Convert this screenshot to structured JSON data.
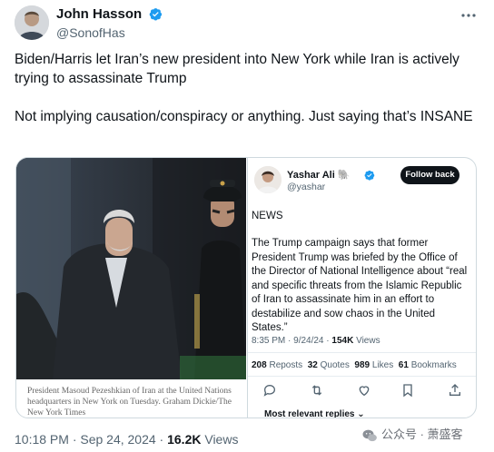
{
  "author": {
    "name": "John Hasson",
    "handle": "@SonofHas"
  },
  "tweet": {
    "paragraphs": [
      "Biden/Harris let Iran’s new president into New York while Iran is actively trying to assassinate Trump",
      "Not implying causation/conspiracy or anything. Just saying that’s INSANE"
    ],
    "timestamp": "10:18 PM · Sep 24, 2024 · ",
    "views_count": "16.2K",
    "views_label": " Views"
  },
  "quote": {
    "photo_caption": "President Masoud Pezeshkian of Iran at the United Nations headquarters in New York on Tuesday. Graham Dickie/The New York Times",
    "inner": {
      "author_name": "Yashar Ali 🐘",
      "author_handle": "@yashar",
      "follow_label": "Follow back",
      "heading": "NEWS",
      "body": "The Trump campaign says that former President Trump was briefed by the Office of the Director of National Intelligence about “real and specific threats from the Islamic Republic of Iran to assassinate him in an effort to destabilize and sow chaos in the United States.”",
      "time": "8:35 PM · 9/24/24 · ",
      "views_count": "154K",
      "views_label": " Views",
      "reposts_count": "208",
      "reposts_label": " Reposts  ",
      "quotes_count": "32",
      "quotes_label": " Quotes  ",
      "likes_count": "989",
      "likes_label": " Likes  ",
      "bookmarks_count": "61",
      "bookmarks_label": " Bookmarks",
      "more_replies": "Most relevant replies ⌄"
    }
  },
  "watermark": "公众号 · 萧盛客",
  "colors": {
    "verified_blue": "#1d9bf0",
    "text_primary": "#0f1419",
    "text_secondary": "#536471",
    "border": "#cfd9de"
  },
  "icons": [
    "verified-badge-icon",
    "more-options-icon",
    "reply-icon",
    "repost-icon",
    "like-icon",
    "bookmark-icon",
    "share-icon",
    "wechat-icon"
  ]
}
